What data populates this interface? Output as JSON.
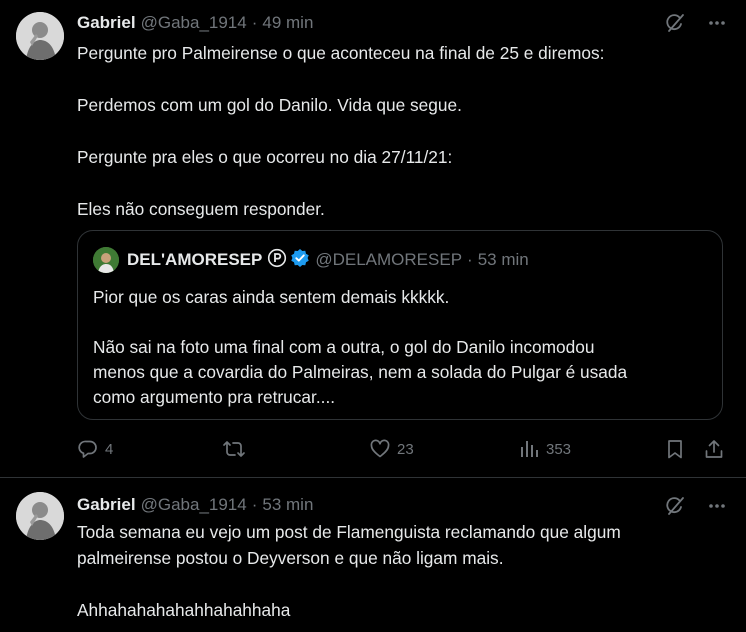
{
  "tweets": [
    {
      "name": "Gabriel",
      "handle": "@Gaba_1914",
      "dot": "·",
      "time": "49 min",
      "paragraphs": [
        "Pergunte pro Palmeirense o que aconteceu na final de 25 e diremos:",
        "Perdemos com um gol do Danilo. Vida que segue.",
        "Pergunte pra eles o que ocorreu no dia 27/11/21:",
        "Eles não conseguem responder."
      ],
      "quote": {
        "name": "DEL'AMORESEP",
        "badge": "Ⓟ",
        "handle": "@DELAMORESEP",
        "dot": "·",
        "time": "53 min",
        "line1": "Pior que os caras ainda sentem demais kkkkk.",
        "line2": "Não sai na foto uma final com a outra, o gol do Danilo incomodou",
        "line3": "menos que a covardia do Palmeiras, nem a solada do Pulgar é usada",
        "line4": "como argumento pra retrucar...."
      },
      "actions": {
        "replies": "4",
        "reposts": "",
        "likes": "23",
        "views": "353"
      }
    },
    {
      "name": "Gabriel",
      "handle": "@Gaba_1914",
      "dot": "·",
      "time": "53 min",
      "line1": "Toda semana eu vejo um post de Flamenguista reclamando que algum",
      "line2": "palmeirense postou o Deyverson e que não ligam mais.",
      "line3": "Ahhahahahahahhahahhaha"
    }
  ],
  "icons": {
    "grok": "grok-icon",
    "more": "more-icon",
    "reply": "reply-icon",
    "repost": "repost-icon",
    "like": "heart-icon",
    "views": "views-icon",
    "bookmark": "bookmark-icon",
    "share": "share-icon",
    "verified": "verified-icon"
  },
  "colors": {
    "background": "#000000",
    "text": "#e7e9ea",
    "muted": "#71767b",
    "border": "#2f3336",
    "verified": "#1d9bf0"
  }
}
